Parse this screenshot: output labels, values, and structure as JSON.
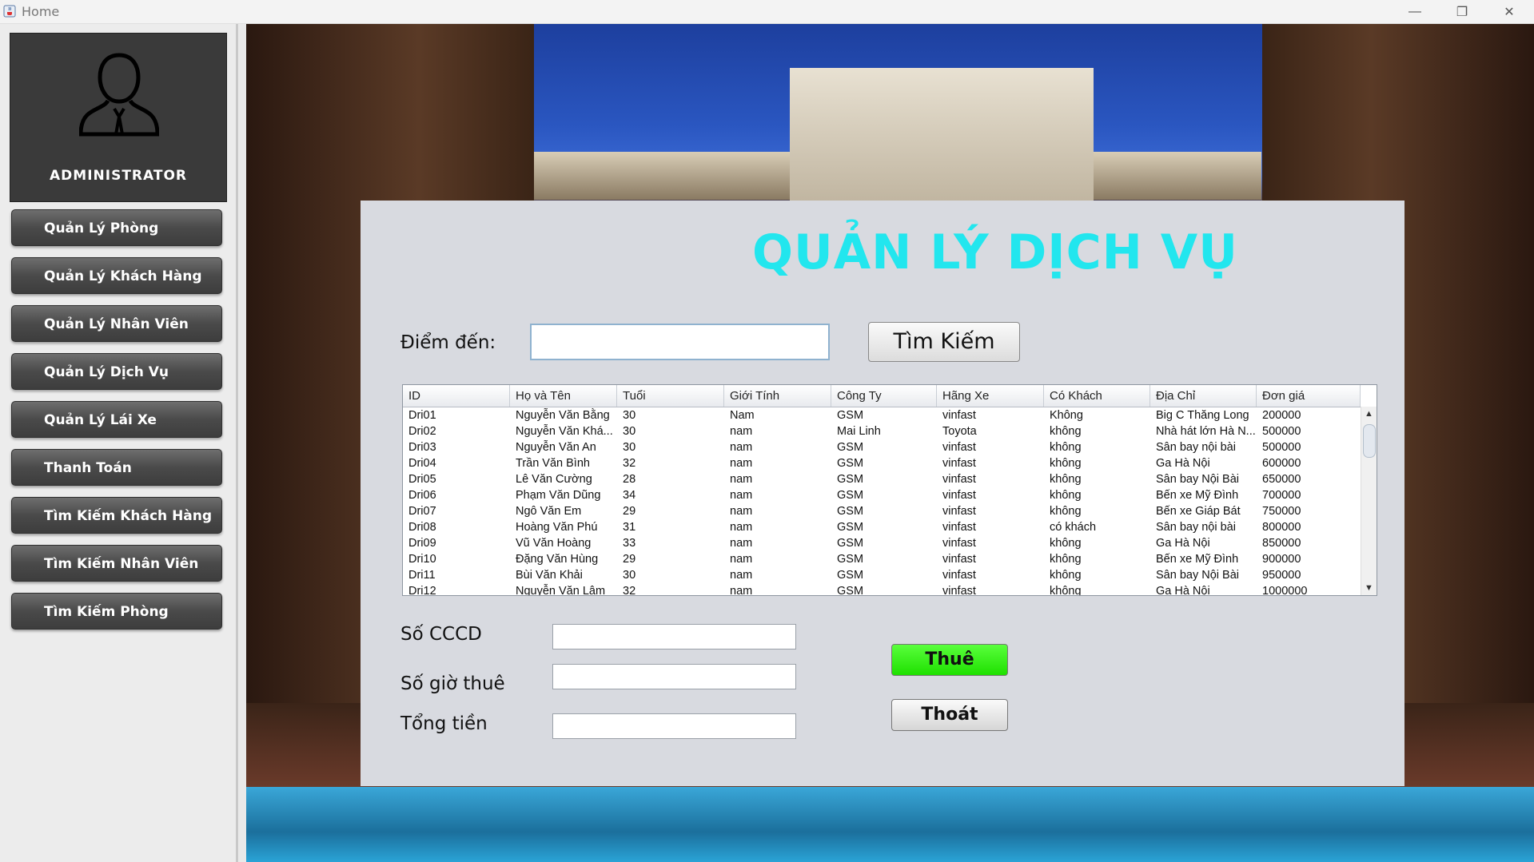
{
  "window": {
    "title": "Home",
    "controls": {
      "minimize": "—",
      "restore": "❐",
      "close": "✕"
    }
  },
  "sidebar": {
    "admin_label": "ADMINISTRATOR",
    "items": [
      {
        "label": "Quản Lý Phòng"
      },
      {
        "label": "Quản Lý Khách Hàng"
      },
      {
        "label": "Quản Lý Nhân Viên"
      },
      {
        "label": "Quản Lý Dịch Vụ"
      },
      {
        "label": "Quản Lý Lái Xe"
      },
      {
        "label": "Thanh Toán"
      },
      {
        "label": "Tìm Kiếm Khách Hàng"
      },
      {
        "label": "Tìm Kiếm Nhân Viên"
      },
      {
        "label": "Tìm Kiếm Phòng"
      }
    ]
  },
  "main": {
    "title": "QUẢN LÝ DỊCH VỤ",
    "destination_label": "Điểm đến:",
    "destination_value": "",
    "search_button": "Tìm Kiếm",
    "table": {
      "columns": [
        "ID",
        "Họ và Tên",
        "Tuổi",
        "Giới Tính",
        "Công Ty",
        "Hãng Xe",
        "Có Khách",
        "Địa Chỉ",
        "Đơn giá"
      ],
      "rows": [
        [
          "Dri01",
          "Nguyễn Văn Bằng",
          "30",
          "Nam",
          "GSM",
          "vinfast",
          "Không",
          "Big C Thăng Long",
          "200000"
        ],
        [
          "Dri02",
          "Nguyễn Văn Khá...",
          "30",
          "nam",
          "Mai Linh",
          "Toyota",
          "không",
          "Nhà hát lớn Hà N...",
          "500000"
        ],
        [
          "Dri03",
          "Nguyễn Văn An",
          "30",
          "nam",
          "GSM",
          "vinfast",
          "không",
          "Sân bay nội bài",
          "500000"
        ],
        [
          "Dri04",
          "Trần Văn Bình",
          "32",
          "nam",
          "GSM",
          "vinfast",
          "không",
          "Ga Hà Nội",
          "600000"
        ],
        [
          "Dri05",
          "Lê Văn Cường",
          "28",
          "nam",
          "GSM",
          "vinfast",
          "không",
          "Sân bay Nội Bài",
          "650000"
        ],
        [
          "Dri06",
          "Phạm Văn Dũng",
          "34",
          "nam",
          "GSM",
          "vinfast",
          "không",
          "Bến xe Mỹ Đình",
          "700000"
        ],
        [
          "Dri07",
          "Ngô Văn Em",
          "29",
          "nam",
          "GSM",
          "vinfast",
          "không",
          "Bến xe Giáp Bát",
          "750000"
        ],
        [
          "Dri08",
          "Hoàng Văn Phú",
          "31",
          "nam",
          "GSM",
          "vinfast",
          "có khách",
          "Sân bay nội bài",
          "800000"
        ],
        [
          "Dri09",
          "Vũ Văn Hoàng",
          "33",
          "nam",
          "GSM",
          "vinfast",
          "không",
          "Ga Hà Nội",
          "850000"
        ],
        [
          "Dri10",
          "Đặng Văn Hùng",
          "29",
          "nam",
          "GSM",
          "vinfast",
          "không",
          "Bến xe Mỹ Đình",
          "900000"
        ],
        [
          "Dri11",
          "Bùi Văn Khải",
          "30",
          "nam",
          "GSM",
          "vinfast",
          "không",
          "Sân bay Nội Bài",
          "950000"
        ],
        [
          "Dri12",
          "Nguyễn Văn Lâm",
          "32",
          "nam",
          "GSM",
          "vinfast",
          "không",
          "Ga Hà Nội",
          "1000000"
        ]
      ]
    },
    "form": {
      "cccd_label": "Số CCCD",
      "cccd_value": "",
      "hours_label": "Số giờ thuê",
      "hours_value": "",
      "total_label": "Tổng tiền",
      "total_value": ""
    },
    "rent_button": "Thuê",
    "exit_button": "Thoát"
  },
  "colors": {
    "title_cyan": "#22e6ee",
    "rent_green": "#2be81a",
    "sidebar_button": "#4a4a4a"
  },
  "icons": {
    "app": "java-cup-icon",
    "admin_avatar": "user-silhouette-icon",
    "scroll_up": "chevron-up-icon",
    "scroll_down": "chevron-down-icon"
  }
}
